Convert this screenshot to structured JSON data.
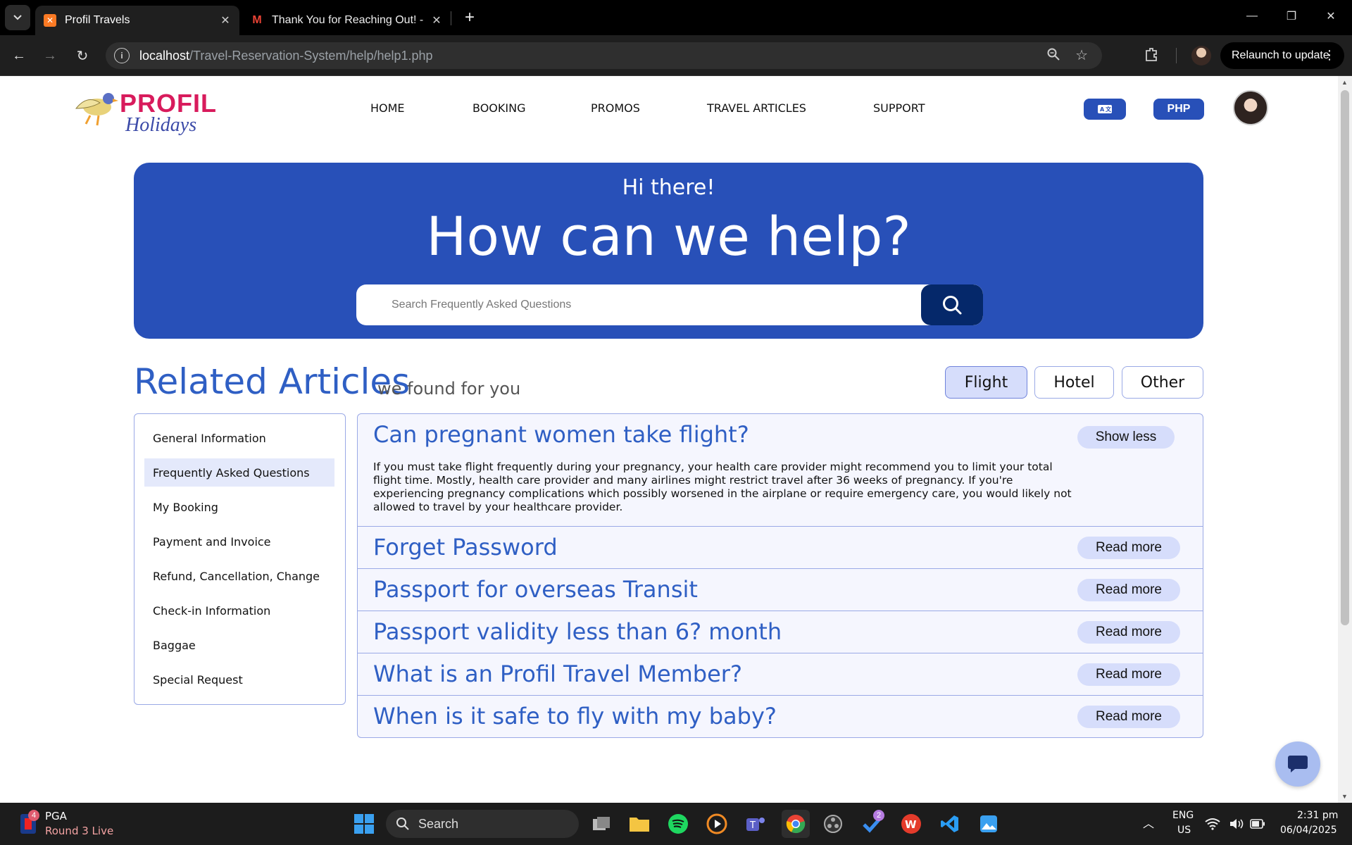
{
  "browser": {
    "tabs": [
      {
        "title": "Profil Travels",
        "active": true
      },
      {
        "title": "Thank You for Reaching Out! - c",
        "active": false
      }
    ],
    "url_host": "localhost",
    "url_path": "/Travel-Reservation-System/help/help1.php",
    "relaunch_label": "Relaunch to update"
  },
  "site": {
    "logo_word1": "PROFIL",
    "logo_word2": "Holidays",
    "nav": [
      "HOME",
      "BOOKING",
      "PROMOS",
      "TRAVEL ARTICLES",
      "SUPPORT"
    ],
    "currency_label": "PHP"
  },
  "hero": {
    "greeting": "Hi there!",
    "headline": "How can we help?",
    "search_placeholder": "Search Frequently Asked Questions"
  },
  "related": {
    "title": "Related Articles",
    "subtitle": "we found for you",
    "filters": [
      {
        "label": "Flight",
        "selected": true
      },
      {
        "label": "Hotel",
        "selected": false
      },
      {
        "label": "Other",
        "selected": false
      }
    ]
  },
  "sidebar": {
    "items": [
      {
        "label": "General Information",
        "selected": false
      },
      {
        "label": "Frequently Asked Questions",
        "selected": true
      },
      {
        "label": "My Booking",
        "selected": false
      },
      {
        "label": "Payment and Invoice",
        "selected": false
      },
      {
        "label": "Refund, Cancellation, Change",
        "selected": false
      },
      {
        "label": "Check-in Information",
        "selected": false
      },
      {
        "label": "Baggae",
        "selected": false
      },
      {
        "label": "Special Request",
        "selected": false
      }
    ]
  },
  "faqs": [
    {
      "question": "Can pregnant women take flight?",
      "button": "Show less",
      "expanded": true,
      "answer": "If you must take flight frequently during your pregnancy, your health care provider might recommend you to limit your total flight time. Mostly, health care provider and many airlines might restrict travel after 36 weeks of pregnancy. If you're experiencing pregnancy complications which possibly worsened in the airplane or require emergency care, you would likely not allowed to travel by your healthcare provider."
    },
    {
      "question": "Forget Password",
      "button": "Read more",
      "expanded": false
    },
    {
      "question": "Passport for overseas Transit",
      "button": "Read more",
      "expanded": false
    },
    {
      "question": "Passport validity less than 6? month",
      "button": "Read more",
      "expanded": false
    },
    {
      "question": "What is an Profil Travel Member?",
      "button": "Read more",
      "expanded": false
    },
    {
      "question": "When is it safe to fly with my baby?",
      "button": "Read more",
      "expanded": false
    }
  ],
  "taskbar": {
    "widget_title": "PGA",
    "widget_sub": "Round 3 Live",
    "widget_badge": "4",
    "search_label": "Search",
    "todo_badge": "2",
    "lang1": "ENG",
    "lang2": "US",
    "time": "2:31 pm",
    "date": "06/04/2025"
  },
  "colors": {
    "brand_blue": "#2850b8",
    "search_button": "#05286a",
    "heading_blue": "#2f5fc4"
  }
}
